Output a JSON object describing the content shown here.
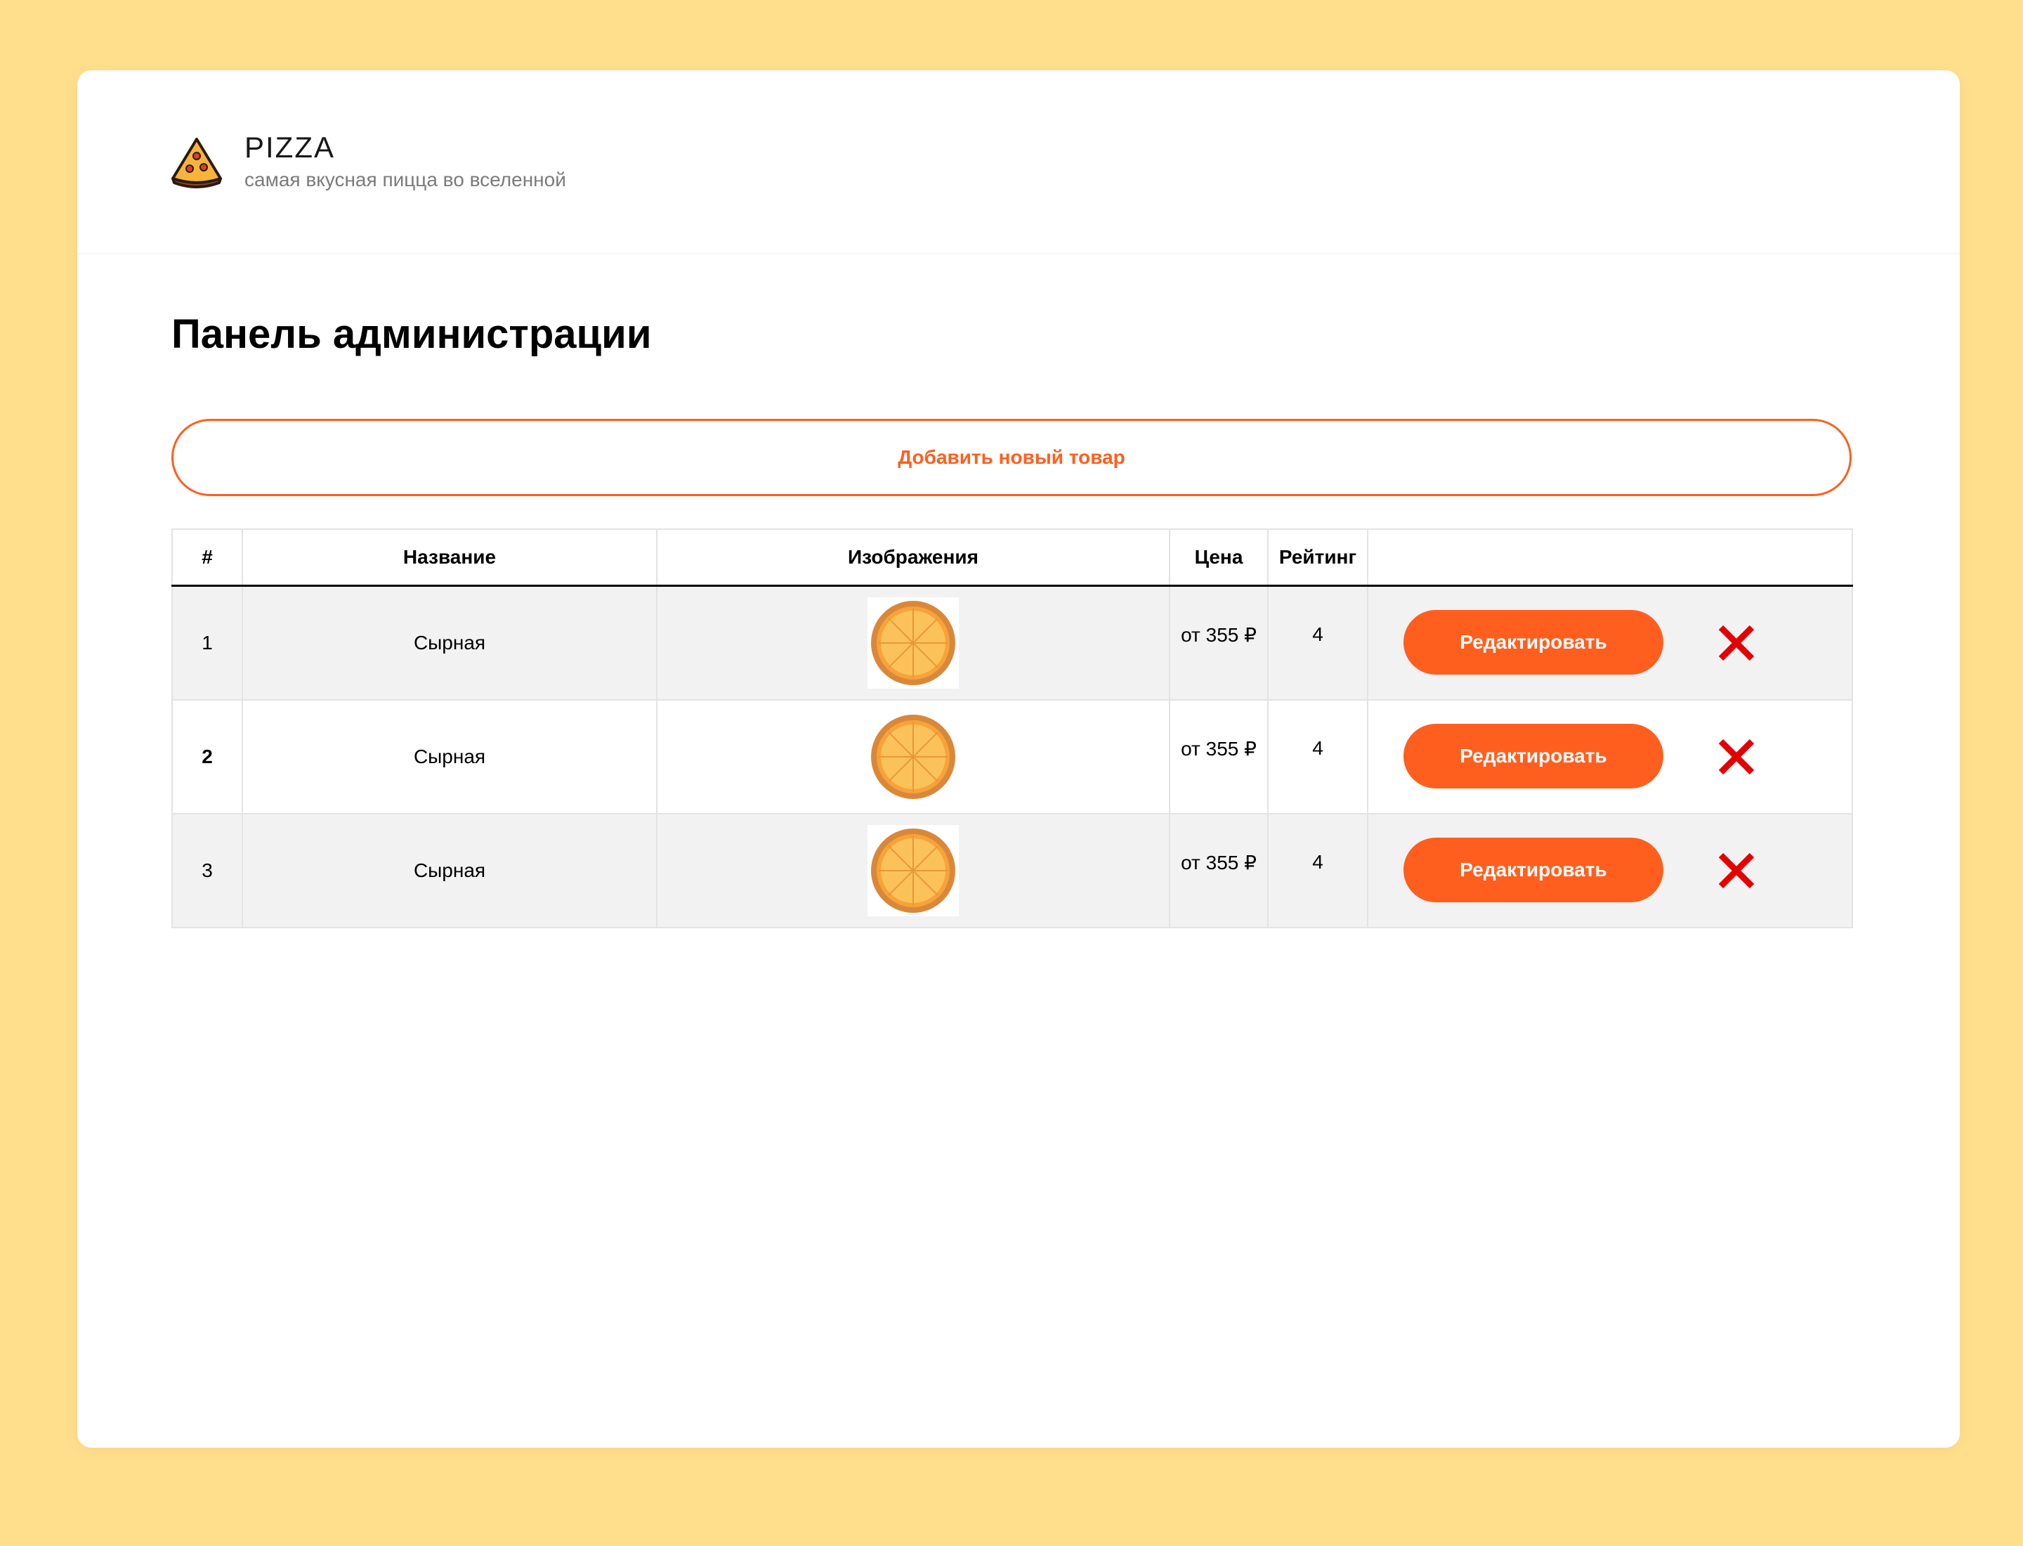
{
  "brand": {
    "title": "PIZZA",
    "subtitle": "самая вкусная пицца во вселенной",
    "logo_icon": "pizza-slice-icon"
  },
  "page": {
    "title": "Панель администрации"
  },
  "add_button": {
    "label": "Добавить новый товар"
  },
  "table": {
    "headers": [
      "#",
      "Название",
      "Изображения",
      "Цена",
      "Рейтинг",
      ""
    ],
    "rows": [
      {
        "num": "1",
        "name": "Сырная",
        "image_icon": "pizza-image",
        "price": "от 355 ₽",
        "rating": "4",
        "edit_label": "Редактировать",
        "delete_icon": "close-icon"
      },
      {
        "num": "2",
        "name": "Сырная",
        "image_icon": "pizza-image",
        "price": "от 355 ₽",
        "rating": "4",
        "edit_label": "Редактировать",
        "delete_icon": "close-icon"
      },
      {
        "num": "3",
        "name": "Сырная",
        "image_icon": "pizza-image",
        "price": "от 355 ₽",
        "rating": "4",
        "edit_label": "Редактировать",
        "delete_icon": "close-icon"
      }
    ]
  },
  "colors": {
    "background": "#FFDF8C",
    "accent": "#FE5F1E",
    "delete": "#E30000",
    "row_alt": "#F2F2F2"
  }
}
